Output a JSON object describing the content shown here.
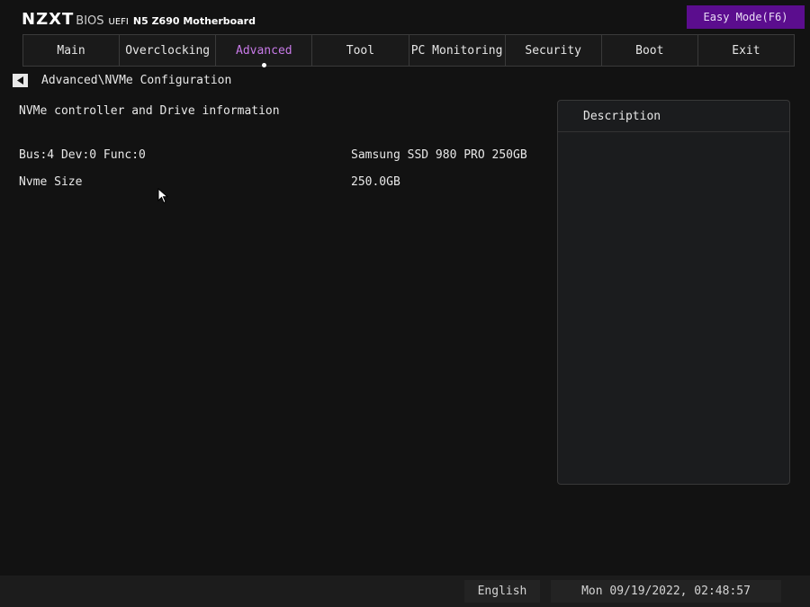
{
  "header": {
    "brand": "NZXT",
    "bios": "BIOS",
    "uefi": "UEFI",
    "model": "N5 Z690 Motherboard",
    "easy_mode": "Easy Mode(F6)",
    "easy_mode_color": "#5b0d8e"
  },
  "tabs": [
    {
      "label": "Main",
      "active": false
    },
    {
      "label": "Overclocking",
      "active": false
    },
    {
      "label": "Advanced",
      "active": true
    },
    {
      "label": "Tool",
      "active": false
    },
    {
      "label": "PC Monitoring",
      "active": false
    },
    {
      "label": "Security",
      "active": false
    },
    {
      "label": "Boot",
      "active": false
    },
    {
      "label": "Exit",
      "active": false
    }
  ],
  "accent_color": "#c87ae8",
  "breadcrumb": {
    "path": "Advanced\\NVMe Configuration",
    "back_icon": "triangle-left-icon"
  },
  "content": {
    "section_title": "NVMe controller and Drive information",
    "rows": [
      {
        "label": "Bus:4 Dev:0 Func:0",
        "value": "Samsung SSD 980 PRO 250GB"
      },
      {
        "label": "Nvme Size",
        "value": "250.0GB"
      }
    ]
  },
  "description": {
    "title": "Description"
  },
  "footer": {
    "language": "English",
    "datetime": "Mon 09/19/2022, 02:48:57"
  }
}
